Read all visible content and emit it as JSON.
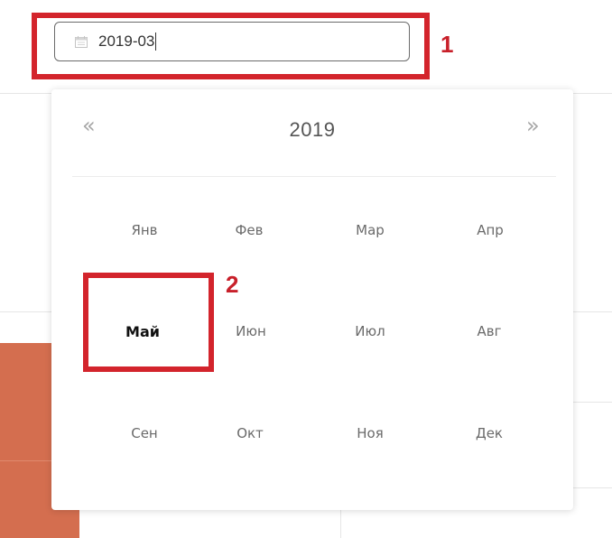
{
  "date_input": {
    "value": "2019-03",
    "icon": "calendar-icon"
  },
  "annotations": [
    "1",
    "2"
  ],
  "picker": {
    "prev_label": "«",
    "next_label": "»",
    "year": "2019",
    "selected_month": "Май",
    "months": [
      "Янв",
      "Фев",
      "Мар",
      "Апр",
      "Май",
      "Июн",
      "Июл",
      "Авг",
      "Сен",
      "Окт",
      "Ноя",
      "Дек"
    ]
  },
  "colors": {
    "annotation": "#d3242c",
    "background_bar": "#d46e4f"
  }
}
